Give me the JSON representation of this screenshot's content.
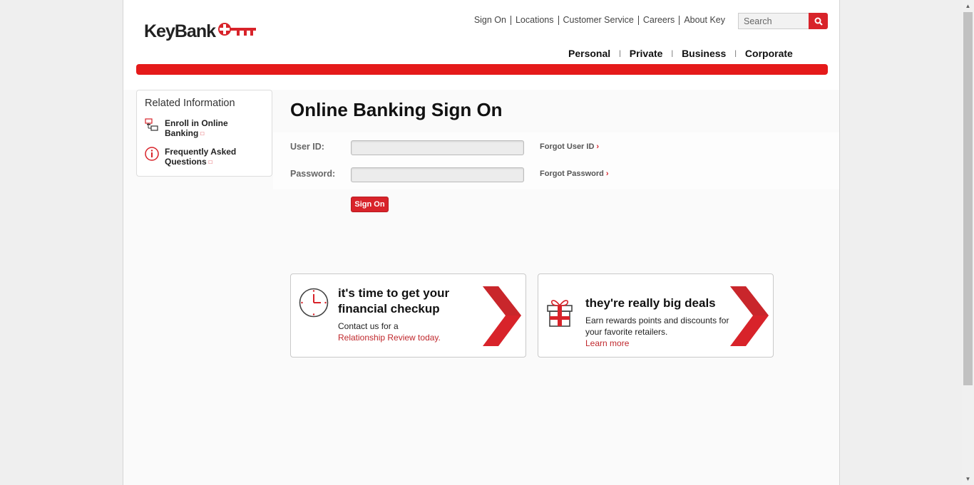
{
  "header": {
    "logo_text": "KeyBank",
    "utility_links": [
      "Sign On",
      "Locations",
      "Customer Service",
      "Careers",
      "About Key"
    ],
    "search_placeholder": "Search",
    "main_nav": [
      "Personal",
      "Private",
      "Business",
      "Corporate"
    ],
    "accent_color": "#e51a1a"
  },
  "sidebar": {
    "title": "Related Information",
    "items": [
      {
        "label": "Enroll in Online Banking",
        "icon": "computers-icon"
      },
      {
        "label": "Frequently Asked Questions",
        "icon": "info-icon"
      }
    ]
  },
  "signon": {
    "title": "Online Banking Sign On",
    "userid_label": "User ID:",
    "userid_value": "",
    "password_label": "Password:",
    "password_value": "",
    "forgot_userid": "Forgot User ID",
    "forgot_password": "Forgot Password",
    "button_label": "Sign On"
  },
  "promos": [
    {
      "heading": "it's time to get your financial checkup",
      "text": "Contact us for a",
      "link": "Relationship Review today.",
      "icon": "clock-icon"
    },
    {
      "heading": "they're really big deals",
      "text": "Earn rewards points and discounts for your favorite retailers.",
      "link": "Learn more",
      "icon": "gift-icon"
    }
  ]
}
